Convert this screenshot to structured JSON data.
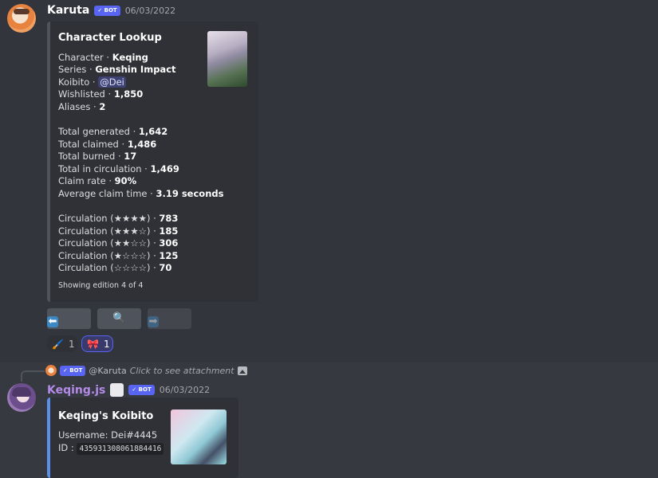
{
  "message1": {
    "username": "Karuta",
    "bot_badge": "✓ BOT",
    "timestamp": "06/03/2022",
    "embed": {
      "title": "Character Lookup",
      "rows": [
        {
          "label": "Character · ",
          "value": "Keqing"
        },
        {
          "label": "Series · ",
          "value": "Genshin Impact"
        },
        {
          "label": "Koibito · ",
          "value": "@Dei",
          "mention": true
        },
        {
          "label": "Wishlisted · ",
          "value": "1,850"
        },
        {
          "label": "Aliases · ",
          "value": "2"
        }
      ],
      "stats": [
        {
          "label": "Total generated · ",
          "value": "1,642"
        },
        {
          "label": "Total claimed · ",
          "value": "1,486"
        },
        {
          "label": "Total burned · ",
          "value": "17"
        },
        {
          "label": "Total in circulation · ",
          "value": "1,469"
        },
        {
          "label": "Claim rate · ",
          "value": "90%"
        },
        {
          "label": "Average claim time · ",
          "value": "3.19 seconds"
        }
      ],
      "circulation": [
        {
          "label": "Circulation (★★★★) · ",
          "value": "783"
        },
        {
          "label": "Circulation (★★★☆) · ",
          "value": "185"
        },
        {
          "label": "Circulation (★★☆☆) · ",
          "value": "306"
        },
        {
          "label": "Circulation (★☆☆☆) · ",
          "value": "125"
        },
        {
          "label": "Circulation (☆☆☆☆) · ",
          "value": "70"
        }
      ],
      "footer": "Showing edition 4 of 4"
    },
    "buttons": {
      "prev": "⬅",
      "search": "🔍",
      "next": "➡"
    },
    "reactions": [
      {
        "emoji": "🖌️",
        "count": "1"
      },
      {
        "emoji": "🎀",
        "count": "1"
      }
    ]
  },
  "message2": {
    "reply": {
      "badge": "✓ BOT",
      "name": "@Karuta",
      "text": "Click to see attachment"
    },
    "username": "Keqing.js",
    "bot_badge": "✓ BOT",
    "timestamp": "06/03/2022",
    "embed": {
      "title": "Keqing's Koibito",
      "username_label": "Username: ",
      "username_value": "Dei#4445",
      "id_label": "ID : ",
      "id_value": "435931308061884416"
    }
  },
  "colors": {
    "background": "#36393f",
    "embed_bg": "#2f3136",
    "blurple": "#5865f2",
    "keqing_name": "#b48ae8"
  }
}
